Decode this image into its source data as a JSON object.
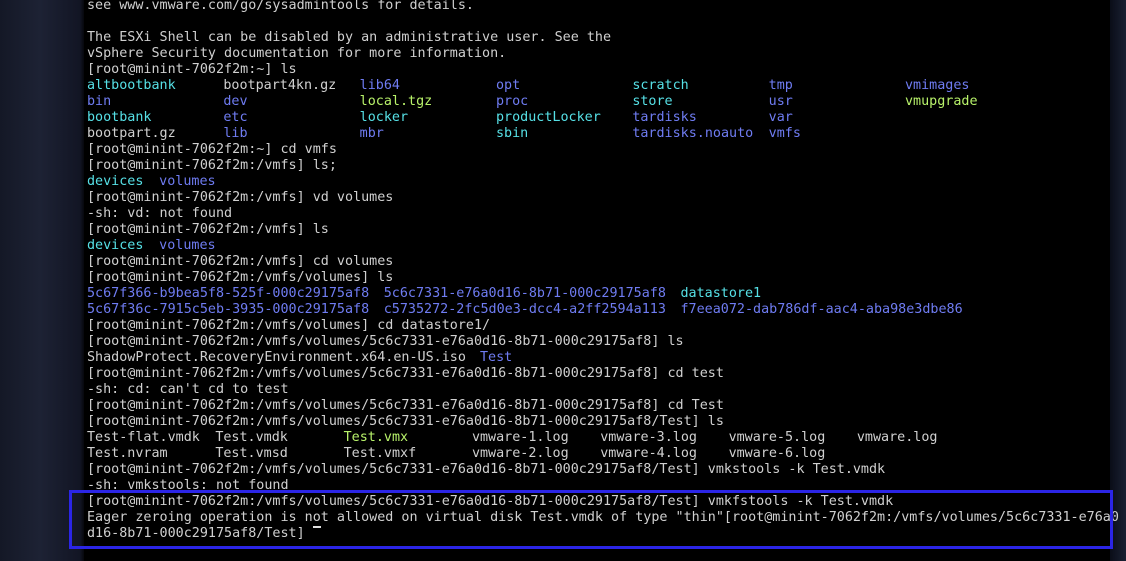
{
  "terminal": {
    "lines": [
      [
        {
          "t": "see www.vmware.com/go/sysadmintools for details.",
          "c": "grey"
        }
      ],
      [
        {
          "t": "",
          "c": "grey"
        }
      ],
      [
        {
          "t": "The ESXi Shell can be disabled by an administrative user. See the",
          "c": "grey"
        }
      ],
      [
        {
          "t": "vSphere Security documentation for more information.",
          "c": "grey"
        }
      ],
      [
        {
          "t": "[root@minint-7062f2m:~] ls",
          "c": "grey"
        }
      ],
      [
        {
          "t": "altbootbank",
          "c": "cyan",
          "w": 17
        },
        {
          "t": "bootpart4kn.gz",
          "c": "grey",
          "w": 17
        },
        {
          "t": "lib64",
          "c": "blue",
          "w": 17
        },
        {
          "t": "opt",
          "c": "blue",
          "w": 17
        },
        {
          "t": "scratch",
          "c": "cyan",
          "w": 17
        },
        {
          "t": "tmp",
          "c": "blue",
          "w": 17
        },
        {
          "t": "vmimages",
          "c": "blue"
        }
      ],
      [
        {
          "t": "bin",
          "c": "blue",
          "w": 17
        },
        {
          "t": "dev",
          "c": "blue",
          "w": 17
        },
        {
          "t": "local.tgz",
          "c": "green",
          "w": 17
        },
        {
          "t": "proc",
          "c": "blue",
          "w": 17
        },
        {
          "t": "store",
          "c": "cyan",
          "w": 17
        },
        {
          "t": "usr",
          "c": "blue",
          "w": 17
        },
        {
          "t": "vmupgrade",
          "c": "green"
        }
      ],
      [
        {
          "t": "bootbank",
          "c": "cyan",
          "w": 17
        },
        {
          "t": "etc",
          "c": "blue",
          "w": 17
        },
        {
          "t": "locker",
          "c": "cyan",
          "w": 17
        },
        {
          "t": "productLocker",
          "c": "cyan",
          "w": 17
        },
        {
          "t": "tardisks",
          "c": "blue",
          "w": 17
        },
        {
          "t": "var",
          "c": "blue"
        }
      ],
      [
        {
          "t": "bootpart.gz",
          "c": "grey",
          "w": 17
        },
        {
          "t": "lib",
          "c": "blue",
          "w": 17
        },
        {
          "t": "mbr",
          "c": "blue",
          "w": 17
        },
        {
          "t": "sbin",
          "c": "cyan",
          "w": 17
        },
        {
          "t": "tardisks.noauto",
          "c": "blue",
          "w": 17
        },
        {
          "t": "vmfs",
          "c": "blue"
        }
      ],
      [
        {
          "t": "[root@minint-7062f2m:~] cd vmfs",
          "c": "grey"
        }
      ],
      [
        {
          "t": "[root@minint-7062f2m:/vmfs] ls;",
          "c": "grey"
        }
      ],
      [
        {
          "t": "devices",
          "c": "cyan",
          "w": 9
        },
        {
          "t": "volumes",
          "c": "blue"
        }
      ],
      [
        {
          "t": "[root@minint-7062f2m:/vmfs] vd volumes",
          "c": "grey"
        }
      ],
      [
        {
          "t": "-sh: vd: not found",
          "c": "grey"
        }
      ],
      [
        {
          "t": "[root@minint-7062f2m:/vmfs] ls",
          "c": "grey"
        }
      ],
      [
        {
          "t": "devices",
          "c": "cyan",
          "w": 9
        },
        {
          "t": "volumes",
          "c": "blue"
        }
      ],
      [
        {
          "t": "[root@minint-7062f2m:/vmfs] cd volumes",
          "c": "grey"
        }
      ],
      [
        {
          "t": "[root@minint-7062f2m:/vmfs/volumes] ls",
          "c": "grey"
        }
      ],
      [
        {
          "t": "5c67f366-b9bea5f8-525f-000c29175af8",
          "c": "blue",
          "w": 37
        },
        {
          "t": "5c6c7331-e76a0d16-8b71-000c29175af8",
          "c": "blue",
          "w": 37
        },
        {
          "t": "datastore1",
          "c": "cyan"
        }
      ],
      [
        {
          "t": "5c67f36c-7915c5eb-3935-000c29175af8",
          "c": "blue",
          "w": 37
        },
        {
          "t": "c5735272-2fc5d0e3-dcc4-a2ff2594a113",
          "c": "blue",
          "w": 37
        },
        {
          "t": "f7eea072-dab786df-aac4-aba98e3dbe86",
          "c": "blue"
        }
      ],
      [
        {
          "t": "[root@minint-7062f2m:/vmfs/volumes] cd datastore1/",
          "c": "grey"
        }
      ],
      [
        {
          "t": "[root@minint-7062f2m:/vmfs/volumes/5c6c7331-e76a0d16-8b71-000c29175af8] ls",
          "c": "grey"
        }
      ],
      [
        {
          "t": "ShadowProtect.RecoveryEnvironment.x64.en-US.iso",
          "c": "grey",
          "w": 49
        },
        {
          "t": "Test",
          "c": "blue"
        }
      ],
      [
        {
          "t": "[root@minint-7062f2m:/vmfs/volumes/5c6c7331-e76a0d16-8b71-000c29175af8] cd test",
          "c": "grey"
        }
      ],
      [
        {
          "t": "-sh: cd: can't cd to test",
          "c": "grey"
        }
      ],
      [
        {
          "t": "[root@minint-7062f2m:/vmfs/volumes/5c6c7331-e76a0d16-8b71-000c29175af8] cd Test",
          "c": "grey"
        }
      ],
      [
        {
          "t": "[root@minint-7062f2m:/vmfs/volumes/5c6c7331-e76a0d16-8b71-000c29175af8/Test] ls",
          "c": "grey"
        }
      ],
      [
        {
          "t": "Test-flat.vmdk",
          "c": "grey",
          "w": 16
        },
        {
          "t": "Test.vmdk",
          "c": "grey",
          "w": 16
        },
        {
          "t": "Test.vmx",
          "c": "green",
          "w": 16
        },
        {
          "t": "vmware-1.log",
          "c": "grey",
          "w": 16
        },
        {
          "t": "vmware-3.log",
          "c": "grey",
          "w": 16
        },
        {
          "t": "vmware-5.log",
          "c": "grey",
          "w": 16
        },
        {
          "t": "vmware.log",
          "c": "grey"
        }
      ],
      [
        {
          "t": "Test.nvram",
          "c": "grey",
          "w": 16
        },
        {
          "t": "Test.vmsd",
          "c": "grey",
          "w": 16
        },
        {
          "t": "Test.vmxf",
          "c": "grey",
          "w": 16
        },
        {
          "t": "vmware-2.log",
          "c": "grey",
          "w": 16
        },
        {
          "t": "vmware-4.log",
          "c": "grey",
          "w": 16
        },
        {
          "t": "vmware-6.log",
          "c": "grey"
        }
      ],
      [
        {
          "t": "[root@minint-7062f2m:/vmfs/volumes/5c6c7331-e76a0d16-8b71-000c29175af8/Test] vmkstools -k Test.vmdk",
          "c": "grey"
        }
      ],
      [
        {
          "t": "-sh: vmkstools: not found",
          "c": "grey"
        }
      ],
      [
        {
          "t": "[root@minint-7062f2m:/vmfs/volumes/5c6c7331-e76a0d16-8b71-000c29175af8/Test] vmkfstools -k Test.vmdk",
          "c": "grey"
        }
      ],
      [
        {
          "t": "Eager zeroing operation is not allowed on virtual disk Test.vmdk of type \"thin\"[root@minint-7062f2m:/vmfs/volumes/5c6c7331-e76a0",
          "c": "grey"
        }
      ],
      [
        {
          "t": "d16-8b71-000c29175af8/Test] ",
          "c": "grey"
        }
      ]
    ],
    "cursor_line": 33
  },
  "colors": {
    "text": "#d0d0d0",
    "directory": "#6f7cf2",
    "executable": "#b8f26a",
    "symlink": "#56e0e6",
    "highlight_border": "#2b25e6",
    "background": "#000000"
  }
}
